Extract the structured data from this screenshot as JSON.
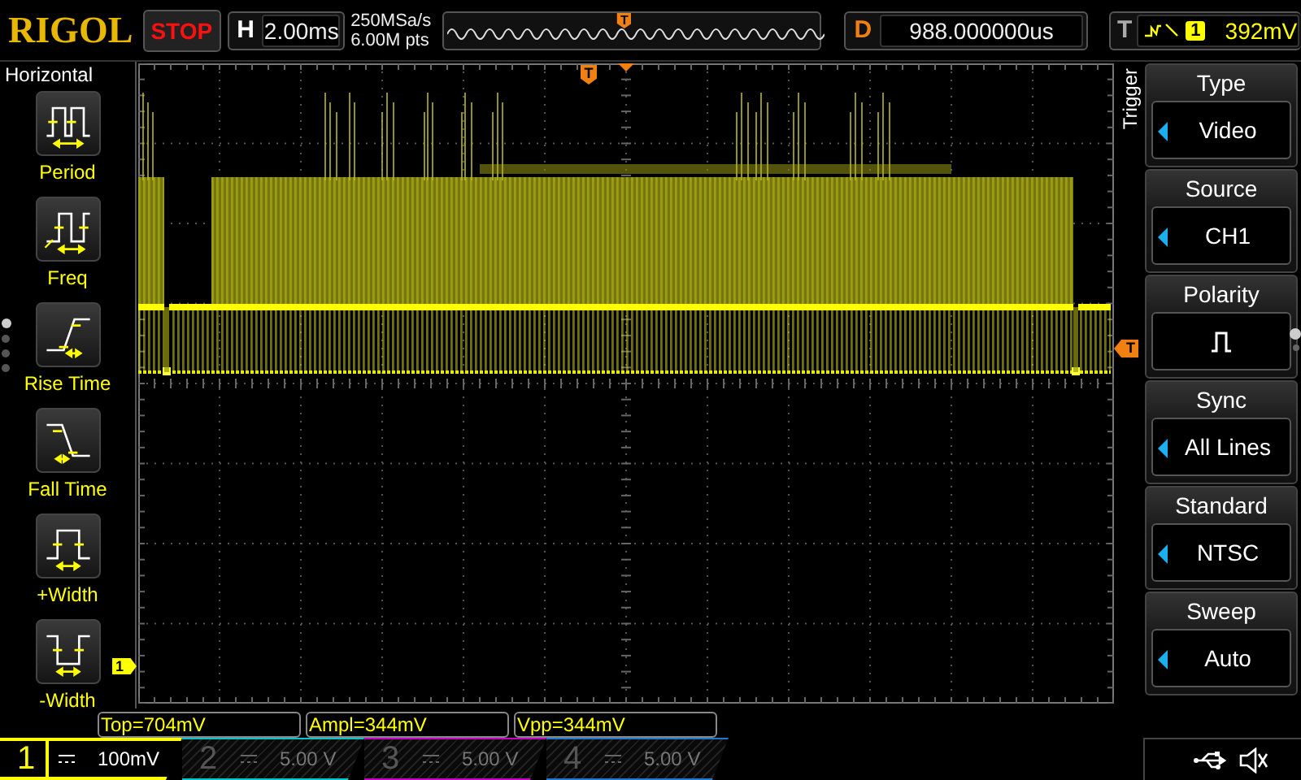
{
  "header": {
    "logo": "RIGOL",
    "run_state": "STOP",
    "timebase": {
      "label": "H",
      "value": "2.00ms"
    },
    "sample_rate": "250MSa/s",
    "memory_depth": "6.00M pts",
    "overview_marker": "T",
    "delay": {
      "label": "D",
      "value": "988.000000us"
    },
    "trigger": {
      "label": "T",
      "source": "1",
      "level": "392mV"
    }
  },
  "left_menu": {
    "title": "Horizontal",
    "items": [
      {
        "label": "Period",
        "kind": "period"
      },
      {
        "label": "Freq",
        "kind": "freq"
      },
      {
        "label": "Rise Time",
        "kind": "rise"
      },
      {
        "label": "Fall Time",
        "kind": "fall"
      },
      {
        "label": "+Width",
        "kind": "pwidth"
      },
      {
        "label": "-Width",
        "kind": "nwidth"
      }
    ],
    "page_dots": [
      {
        "selected": true
      },
      {
        "selected": false
      },
      {
        "selected": false
      },
      {
        "selected": false
      }
    ]
  },
  "grid": {
    "trigger_position_marker": "T",
    "channel_marker": "1",
    "trigger_level_marker": "T"
  },
  "trigger_menu": {
    "title": "Trigger",
    "items": [
      {
        "label": "Type",
        "kind": "select",
        "value": "Video"
      },
      {
        "label": "Source",
        "kind": "select",
        "value": "CH1"
      },
      {
        "label": "Polarity",
        "kind": "toggle"
      },
      {
        "label": "Sync",
        "kind": "select",
        "value": "All Lines"
      },
      {
        "label": "Standard",
        "kind": "select",
        "value": "NTSC"
      },
      {
        "label": "Sweep",
        "kind": "select",
        "value": "Auto"
      }
    ],
    "page_dots": [
      {
        "selected": true
      },
      {
        "selected": false
      }
    ]
  },
  "measurements": [
    "Top=704mV",
    "Ampl=344mV",
    "Vpp=344mV"
  ],
  "channels": [
    {
      "number": "1",
      "scale": "100mV",
      "enabled": true,
      "color": "#ffff00"
    },
    {
      "number": "2",
      "scale": "5.00 V",
      "enabled": false,
      "color": "#00c8c8"
    },
    {
      "number": "3",
      "scale": "5.00 V",
      "enabled": false,
      "color": "#c800c8"
    },
    {
      "number": "4",
      "scale": "5.00 V",
      "enabled": false,
      "color": "#1e7ad0"
    }
  ]
}
